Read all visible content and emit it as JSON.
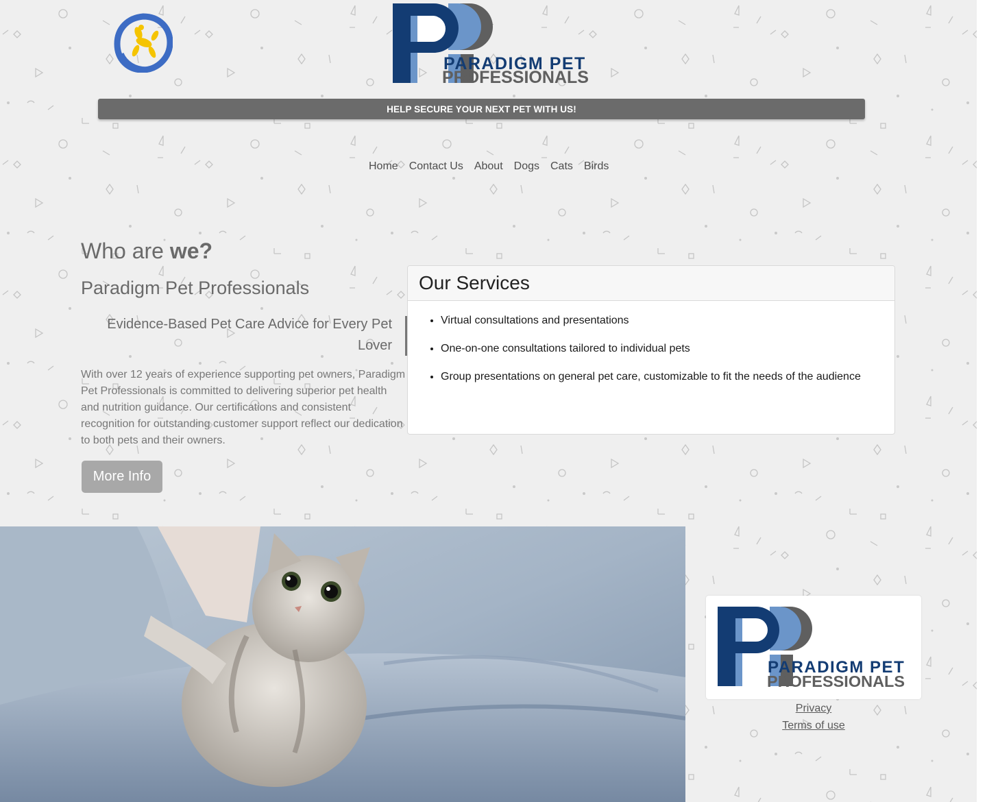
{
  "brand": {
    "name_line1": "PARADIGM PET",
    "name_line2": "PROFESSIONALS",
    "monogram": "PP",
    "colors": {
      "navy": "#133c73",
      "light_blue": "#6b95c9",
      "gray": "#5f5f5f"
    }
  },
  "badge": {
    "icon": "balloon-dog-icon",
    "ring_color": "#3d6cc4",
    "dog_color": "#f5c400"
  },
  "promo": {
    "text": "HELP SECURE YOUR NEXT PET WITH US!"
  },
  "nav": {
    "items": [
      {
        "label": "Home"
      },
      {
        "label": "Contact Us"
      },
      {
        "label": "About"
      },
      {
        "label": "Dogs"
      },
      {
        "label": "Cats"
      },
      {
        "label": "Birds"
      }
    ]
  },
  "about": {
    "heading_prefix": "Who are ",
    "heading_emphasis": "we?",
    "subheading": "Paradigm Pet Professionals",
    "quote": "Evidence-Based Pet Care Advice for Every Pet Lover",
    "body": "With over 12 years of experience supporting pet owners, Paradigm Pet Professionals is committed to delivering superior pet health and nutrition guidance. Our certifications and consistent recognition for outstanding customer support reflect our dedication to both pets and their owners.",
    "button_label": "More Info"
  },
  "services": {
    "title": "Our Services",
    "items": [
      "Virtual consultations and presentations",
      "One-on-one consultations tailored to individual pets",
      "Group presentations on general pet care, customizable to fit the needs of the audience"
    ]
  },
  "photo": {
    "subject": "kitten-on-sofa"
  },
  "footer": {
    "links": [
      {
        "label": "Privacy"
      },
      {
        "label": "Terms of use"
      }
    ]
  }
}
